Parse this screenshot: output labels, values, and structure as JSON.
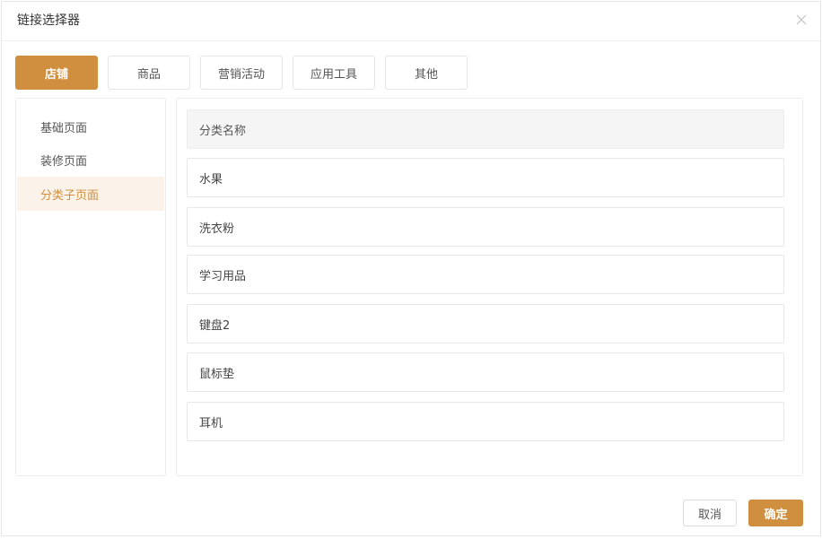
{
  "dialog": {
    "title": "链接选择器",
    "close_icon": "close-icon"
  },
  "tabs": [
    {
      "label": "店铺",
      "active": true
    },
    {
      "label": "商品",
      "active": false
    },
    {
      "label": "营销活动",
      "active": false
    },
    {
      "label": "应用工具",
      "active": false
    },
    {
      "label": "其他",
      "active": false
    }
  ],
  "sidebar": {
    "items": [
      {
        "label": "基础页面",
        "active": false
      },
      {
        "label": "装修页面",
        "active": false
      },
      {
        "label": "分类子页面",
        "active": true
      }
    ]
  },
  "table": {
    "header": "分类名称",
    "rows": [
      "水果",
      "洗衣粉",
      "学习用品",
      "键盘2",
      "鼠标垫",
      "耳机"
    ]
  },
  "footer": {
    "cancel_label": "取消",
    "confirm_label": "确定"
  },
  "colors": {
    "accent": "#d08f3e",
    "active_bg": "#fbf3ea"
  }
}
